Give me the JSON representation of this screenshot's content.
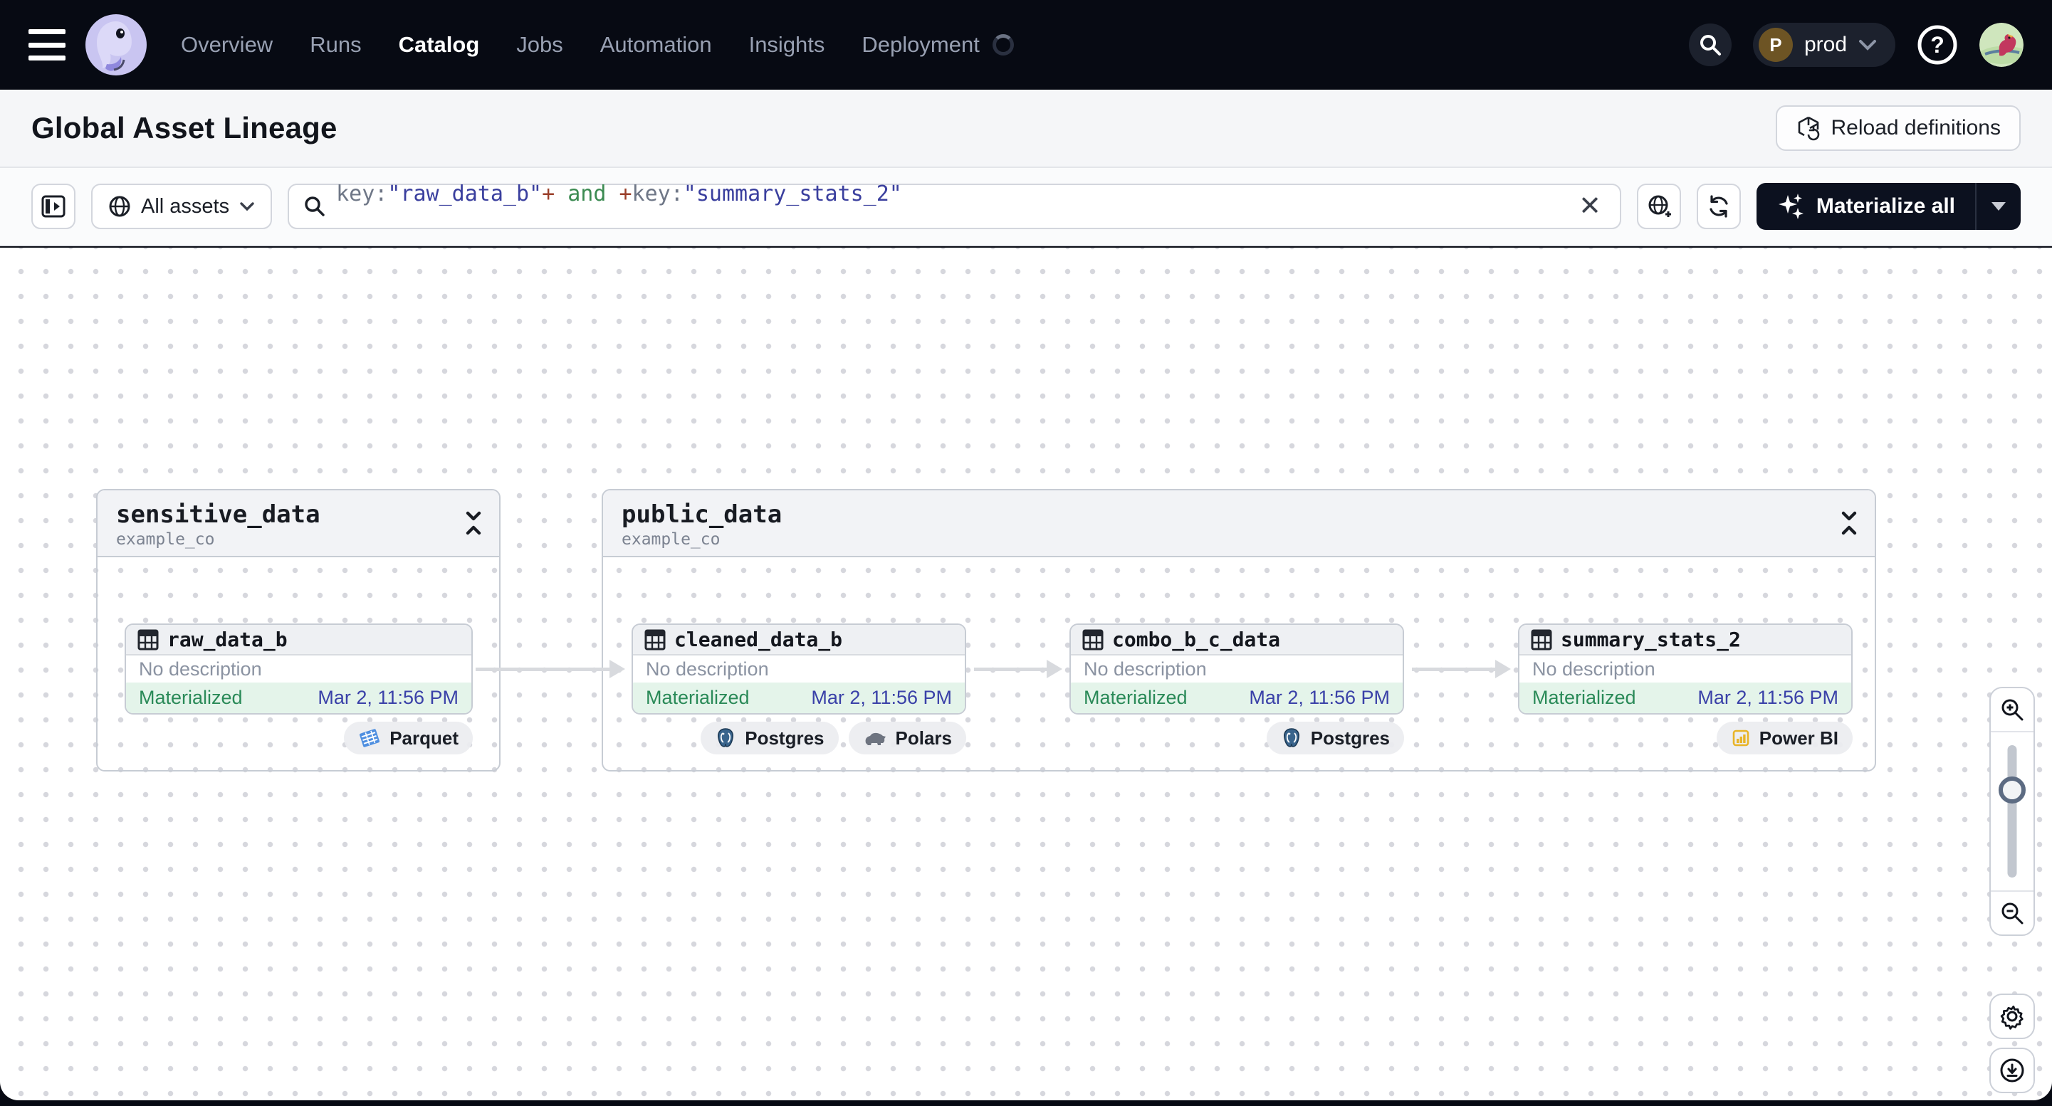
{
  "nav": {
    "items": [
      {
        "label": "Overview"
      },
      {
        "label": "Runs"
      },
      {
        "label": "Catalog"
      },
      {
        "label": "Jobs"
      },
      {
        "label": "Automation"
      },
      {
        "label": "Insights"
      },
      {
        "label": "Deployment"
      }
    ],
    "active_item": "Catalog",
    "environment": {
      "initial": "P",
      "label": "prod"
    }
  },
  "header": {
    "title": "Global Asset Lineage",
    "reload_label": "Reload definitions"
  },
  "toolbar": {
    "filter_label": "All assets",
    "materialize_label": "Materialize all",
    "query": {
      "t0": {
        "text": "key:",
        "color": "#6f7787"
      },
      "t1": {
        "text": "\"raw_data_b\"",
        "color": "#3a3f9e"
      },
      "t2": {
        "text": "+",
        "color": "#9a3f2a"
      },
      "t3": {
        "text": " and ",
        "color": "#3c8b52"
      },
      "t4": {
        "text": "+",
        "color": "#9a3f2a"
      },
      "t5": {
        "text": "key:",
        "color": "#6f7787"
      },
      "t6": {
        "text": "\"summary_stats_2\"",
        "color": "#3a3f9e"
      }
    }
  },
  "groups": {
    "sensitive": {
      "title": "sensitive_data",
      "subtitle": "example_co",
      "nodes": {
        "raw_data_b": {
          "name": "raw_data_b",
          "description": "No description",
          "status": "Materialized",
          "timestamp": "Mar 2, 11:56 PM",
          "badge0": "Parquet"
        }
      }
    },
    "public": {
      "title": "public_data",
      "subtitle": "example_co",
      "nodes": {
        "cleaned_data_b": {
          "name": "cleaned_data_b",
          "description": "No description",
          "status": "Materialized",
          "timestamp": "Mar 2, 11:56 PM",
          "badge0": "Postgres",
          "badge1": "Polars"
        },
        "combo_b_c_data": {
          "name": "combo_b_c_data",
          "description": "No description",
          "status": "Materialized",
          "timestamp": "Mar 2, 11:56 PM",
          "badge0": "Postgres"
        },
        "summary_stats_2": {
          "name": "summary_stats_2",
          "description": "No description",
          "status": "Materialized",
          "timestamp": "Mar 2, 11:56 PM",
          "badge0": "Power BI"
        }
      }
    }
  },
  "colors": {
    "nav_bg": "#070a13",
    "accent_dark_button": "#0c111f",
    "status_green": "#2a8a58",
    "status_bg": "#e4f4ea",
    "timestamp_indigo": "#3a41a8",
    "edge_gray": "#d8dade",
    "group_border": "#c7ccd4"
  }
}
